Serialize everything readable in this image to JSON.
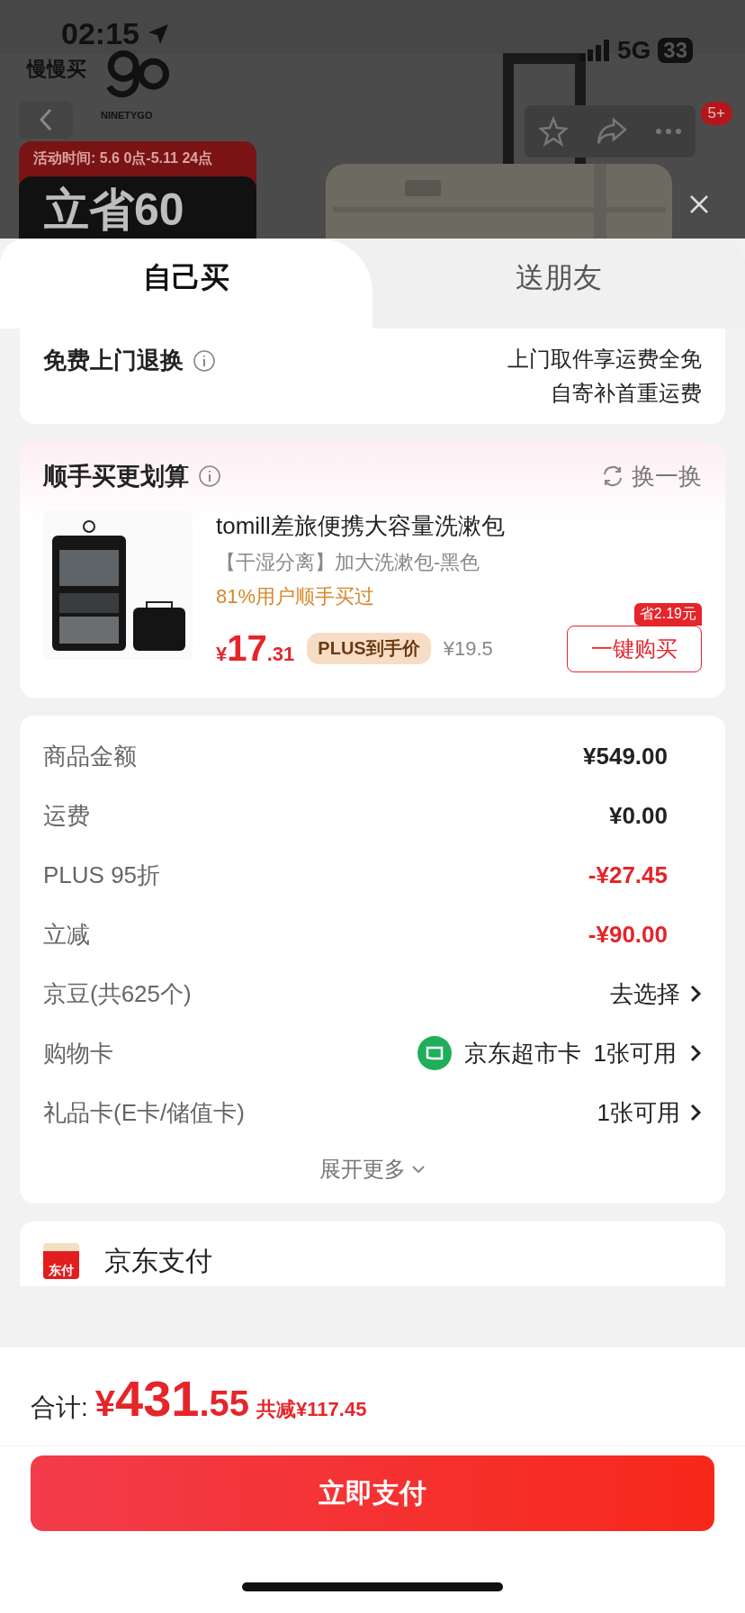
{
  "status_bar": {
    "time": "02:15",
    "network": "5G",
    "battery": "33"
  },
  "back_label": "慢慢买",
  "brand": "NINETYGO",
  "promo": {
    "period": "活动时间: 5.6 0点-5.11 24点",
    "headline": "立省60"
  },
  "notification_badge": "5+",
  "tabs": [
    {
      "label": "自己买",
      "selected": true
    },
    {
      "label": "送朋友",
      "selected": false
    }
  ],
  "return_service": {
    "label": "免费上门退换",
    "lines": [
      "上门取件享运费全免",
      "自寄补首重运费"
    ]
  },
  "addon": {
    "title": "顺手买更划算",
    "refresh": "换一换",
    "product": {
      "kind": "picture",
      "name": "tomill差旅便携大容量洗漱包",
      "variant": "【干湿分离】加大洗漱包-黑色",
      "social_proof": "81%用户顺手买过",
      "currency": "¥",
      "price_int": "17",
      "price_dec": ".31",
      "price_tag": "PLUS到手价",
      "original_price": "¥19.5",
      "saving_badge": "省2.19元",
      "buy_button": "一键购买"
    }
  },
  "summary": {
    "rows": [
      {
        "kind": "amount",
        "label": "商品金额",
        "value": "¥549.00",
        "discount": false
      },
      {
        "kind": "amount",
        "label": "运费",
        "value": "¥0.00",
        "discount": false
      },
      {
        "kind": "amount",
        "label": "PLUS 95折",
        "value": "-¥27.45",
        "discount": true
      },
      {
        "kind": "amount",
        "label": "立减",
        "value": "-¥90.00",
        "discount": true
      },
      {
        "kind": "link",
        "label": "京豆(共625个)",
        "value": "去选择"
      },
      {
        "kind": "card",
        "label": "购物卡",
        "card_name": "京东超市卡",
        "value": "1张可用"
      },
      {
        "kind": "link",
        "label": "礼品卡(E卡/储值卡)",
        "value": "1张可用"
      }
    ],
    "expand": "展开更多"
  },
  "payment": {
    "icon_text": "东付",
    "method": "京东支付"
  },
  "total": {
    "label": "合计:",
    "currency": "¥",
    "amount_int": "431",
    "amount_dec": ".55",
    "saving": "共减¥117.45"
  },
  "pay_button": "立即支付"
}
